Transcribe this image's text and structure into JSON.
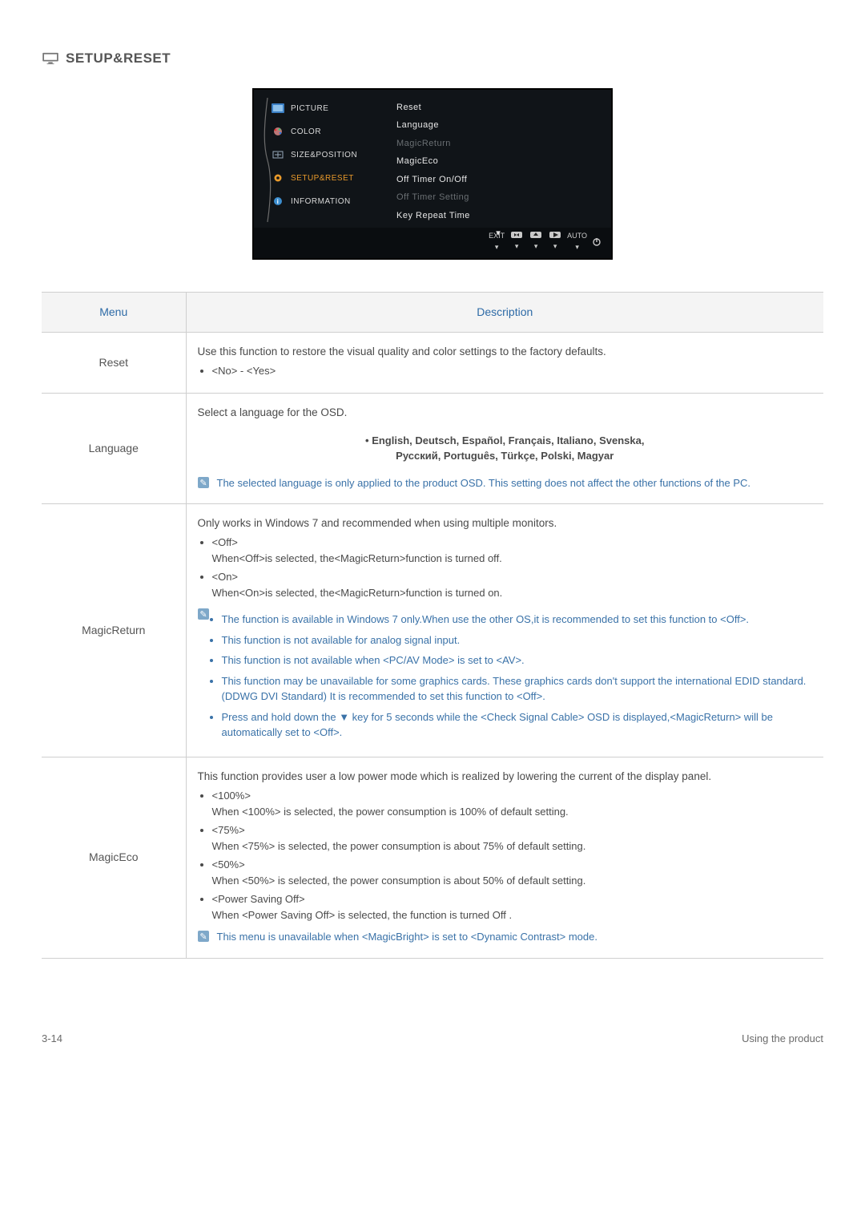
{
  "section_title": "SETUP&RESET",
  "osd": {
    "left": [
      {
        "label": "PICTURE"
      },
      {
        "label": "COLOR"
      },
      {
        "label": "SIZE&POSITION"
      },
      {
        "label": "SETUP&RESET"
      },
      {
        "label": "INFORMATION"
      }
    ],
    "right": [
      {
        "label": "Reset",
        "dim": false
      },
      {
        "label": "Language",
        "dim": false
      },
      {
        "label": "MagicReturn",
        "dim": true
      },
      {
        "label": "MagicEco",
        "dim": false
      },
      {
        "label": "Off Timer On/Off",
        "dim": false
      },
      {
        "label": "Off Timer Setting",
        "dim": true
      },
      {
        "label": "Key Repeat Time",
        "dim": false
      }
    ],
    "bottom": {
      "exit": "EXIT",
      "auto": "AUTO"
    }
  },
  "table": {
    "headers": {
      "menu": "Menu",
      "desc": "Description"
    },
    "reset": {
      "label": "Reset",
      "intro": "Use this function to restore the visual quality and color settings to the factory defaults.",
      "option": "<No> - <Yes>"
    },
    "language": {
      "label": "Language",
      "intro": "Select a language for the OSD.",
      "list_a": "• English, Deutsch, Español, Français, Italiano, Svenska,",
      "list_b": "Русский, Português, Türkçe, Polski, Magyar",
      "note": "The selected language is only applied to the product OSD. This setting does not affect the other functions of the PC."
    },
    "magicreturn": {
      "label": "MagicReturn",
      "intro": "Only works in Windows 7 and recommended when using multiple monitors.",
      "off_head": "<Off>",
      "off_body": "When<Off>is selected, the<MagicReturn>function is turned off.",
      "on_head": "<On>",
      "on_body": "When<On>is selected, the<MagicReturn>function is turned on.",
      "notes": [
        "The function is available in Windows 7 only.When use the other OS,it is recommended to set this function to <Off>.",
        "This function is not available for analog signal input.",
        "This function is not available when <PC/AV Mode> is set to <AV>.",
        "This function may be unavailable for some graphics cards. These graphics cards don't support the international EDID standard.(DDWG DVI Standard) It is recommended to set this function to <Off>.",
        "Press and hold down the ▼ key for 5 seconds while the <Check Signal Cable> OSD is displayed,<MagicReturn> will be automatically set to <Off>."
      ]
    },
    "magiceco": {
      "label": "MagicEco",
      "intro": "This function provides user a low power mode which is realized by lowering the current of the display panel.",
      "opts": [
        {
          "head": "<100%>",
          "body": "When <100%> is selected, the power consumption is 100% of default setting."
        },
        {
          "head": "<75%>",
          "body": "When <75%> is selected, the power consumption is about 75% of default setting."
        },
        {
          "head": "<50%>",
          "body": "When <50%> is selected, the power consumption is about 50% of default setting."
        },
        {
          "head": "<Power Saving Off>",
          "body": "When <Power Saving Off> is selected, the function is turned Off ."
        }
      ],
      "note": "This menu is unavailable when <MagicBright> is set to <Dynamic Contrast> mode."
    }
  },
  "footer": {
    "left": "3-14",
    "right": "Using the product"
  }
}
